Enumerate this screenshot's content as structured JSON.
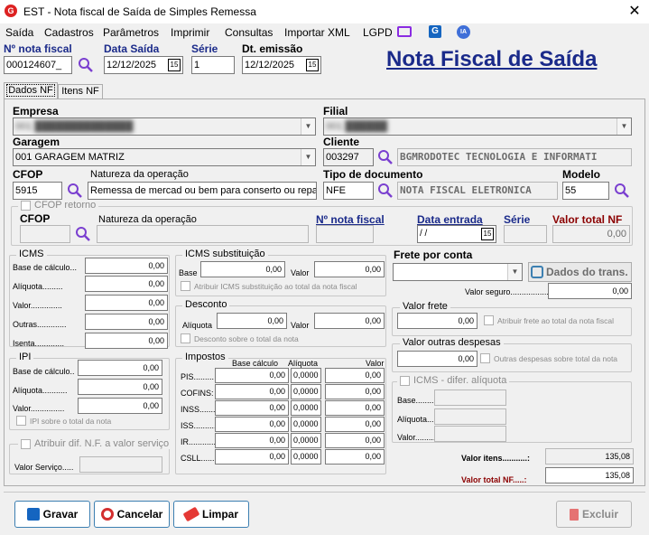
{
  "window": {
    "title": "EST - Nota fiscal de Saída de Simples Remessa",
    "close": "✕"
  },
  "menu": [
    "Saída",
    "Cadastros",
    "Parâmetros",
    "Imprimir",
    "Consultas",
    "Importar XML",
    "LGPD"
  ],
  "menu_icons": {
    "g": "G",
    "ia": "IA"
  },
  "header": {
    "nota_label": "Nº nota fiscal",
    "nota_value": "000124607_",
    "data_saida_label": "Data Saída",
    "data_saida_value": "12/12/2025",
    "serie_label": "Série",
    "serie_value": "1",
    "dt_emissao_label": "Dt. emissão",
    "dt_emissao_value": "12/12/2025",
    "page_title": "Nota Fiscal de Saída"
  },
  "tabs": [
    "Dados NF",
    "Itens NF"
  ],
  "form": {
    "empresa_label": "Empresa",
    "empresa_value": "001 ██████████████",
    "filial_label": "Filial",
    "filial_value": "001 ██████",
    "garagem_label": "Garagem",
    "garagem_value": "001 GARAGEM MATRIZ",
    "cliente_label": "Cliente",
    "cliente_code": "003297",
    "cliente_name": "BGMRODOTEC TECNOLOGIA E INFORMATI",
    "cfop_label": "CFOP",
    "cfop_value": "5915",
    "natureza_label": "Natureza da operação",
    "natureza_value": "Remessa de mercad ou bem para conserto ou reparo",
    "tipo_doc_label": "Tipo de documento",
    "tipo_doc_code": "NFE",
    "tipo_doc_name": "NOTA FISCAL ELETRONICA",
    "modelo_label": "Modelo",
    "modelo_value": "55"
  },
  "cfop_retorno": {
    "check_label": "CFOP retorno",
    "cfop_label": "CFOP",
    "natureza_label": "Natureza da operação",
    "nota_label": "Nº nota fiscal",
    "data_label": "Data entrada",
    "data_value": " /  /",
    "serie_label": "Série",
    "valor_label": "Valor total NF",
    "valor_value": "0,00"
  },
  "icms": {
    "title": "ICMS",
    "base": "Base de cálculo...",
    "aliquota": "Alíquota.........",
    "valor": "Valor..............",
    "outras": "Outras.............",
    "isenta": "Isenta.............",
    "values": [
      "0,00",
      "0,00",
      "0,00",
      "0,00",
      "0,00"
    ]
  },
  "icms_st": {
    "title": "ICMS substituição",
    "base": "Base",
    "valor": "Valor",
    "base_value": "0,00",
    "valor_value": "0,00",
    "check": "Atribuir ICMS substituição ao total da nota fiscal"
  },
  "desconto": {
    "title": "Desconto",
    "aliquota": "Alíquota",
    "valor": "Valor",
    "aliquota_value": "0,00",
    "valor_value": "0,00",
    "check": "Desconto sobre o total da nota"
  },
  "ipi": {
    "title": "IPI",
    "base": "Base de cálculo..",
    "aliquota": "Alíquota...........",
    "valor": "Valor...............",
    "values": [
      "0,00",
      "0,00",
      "0,00"
    ],
    "check": "IPI sobre o total da nota"
  },
  "atribuir": {
    "check": "Atribuir dif. N.F. a valor serviço",
    "label": "Valor Serviço....."
  },
  "impostos": {
    "title": "Impostos",
    "col_base": "Base cálculo",
    "col_aliq": "Alíquota",
    "col_valor": "Valor",
    "rows": [
      {
        "name": "PIS.........",
        "base": "0,00",
        "aliq": "0,0000",
        "valor": "0,00"
      },
      {
        "name": "COFINS:",
        "base": "0,00",
        "aliq": "0,0000",
        "valor": "0,00"
      },
      {
        "name": "INSS.......",
        "base": "0,00",
        "aliq": "0,0000",
        "valor": "0,00"
      },
      {
        "name": "ISS..........",
        "base": "0,00",
        "aliq": "0,0000",
        "valor": "0,00"
      },
      {
        "name": "IR............",
        "base": "0,00",
        "aliq": "0,0000",
        "valor": "0,00"
      },
      {
        "name": "CSLL.......",
        "base": "0,00",
        "aliq": "0,0000",
        "valor": "0,00"
      }
    ]
  },
  "frete": {
    "label": "Frete por conta",
    "dados_btn": "Dados do trans.",
    "valor_seguro_label": "Valor seguro.................",
    "valor_seguro_value": "0,00",
    "valor_frete_title": "Valor frete",
    "valor_frete_value": "0,00",
    "frete_check": "Atribuir frete ao total da nota fiscal",
    "outras_title": "Valor outras despesas",
    "outras_value": "0,00",
    "outras_check": "Outras despesas sobre total da nota",
    "icms_dif_check": "ICMS - difer. alíquota",
    "base": "Base.........",
    "aliquota": "Alíquota.......",
    "valor": "Valor.........."
  },
  "totais": {
    "itens_label": "Valor itens...........:",
    "itens_value": "135,08",
    "total_label": "Valor total NF.....:",
    "total_value": "135,08"
  },
  "buttons": {
    "gravar": "Gravar",
    "cancelar": "Cancelar",
    "limpar": "Limpar",
    "excluir": "Excluir"
  },
  "colors": {
    "title_blue": "#1a2a8a",
    "total_red": "#8b0000",
    "accent": "#3c7fb1"
  }
}
